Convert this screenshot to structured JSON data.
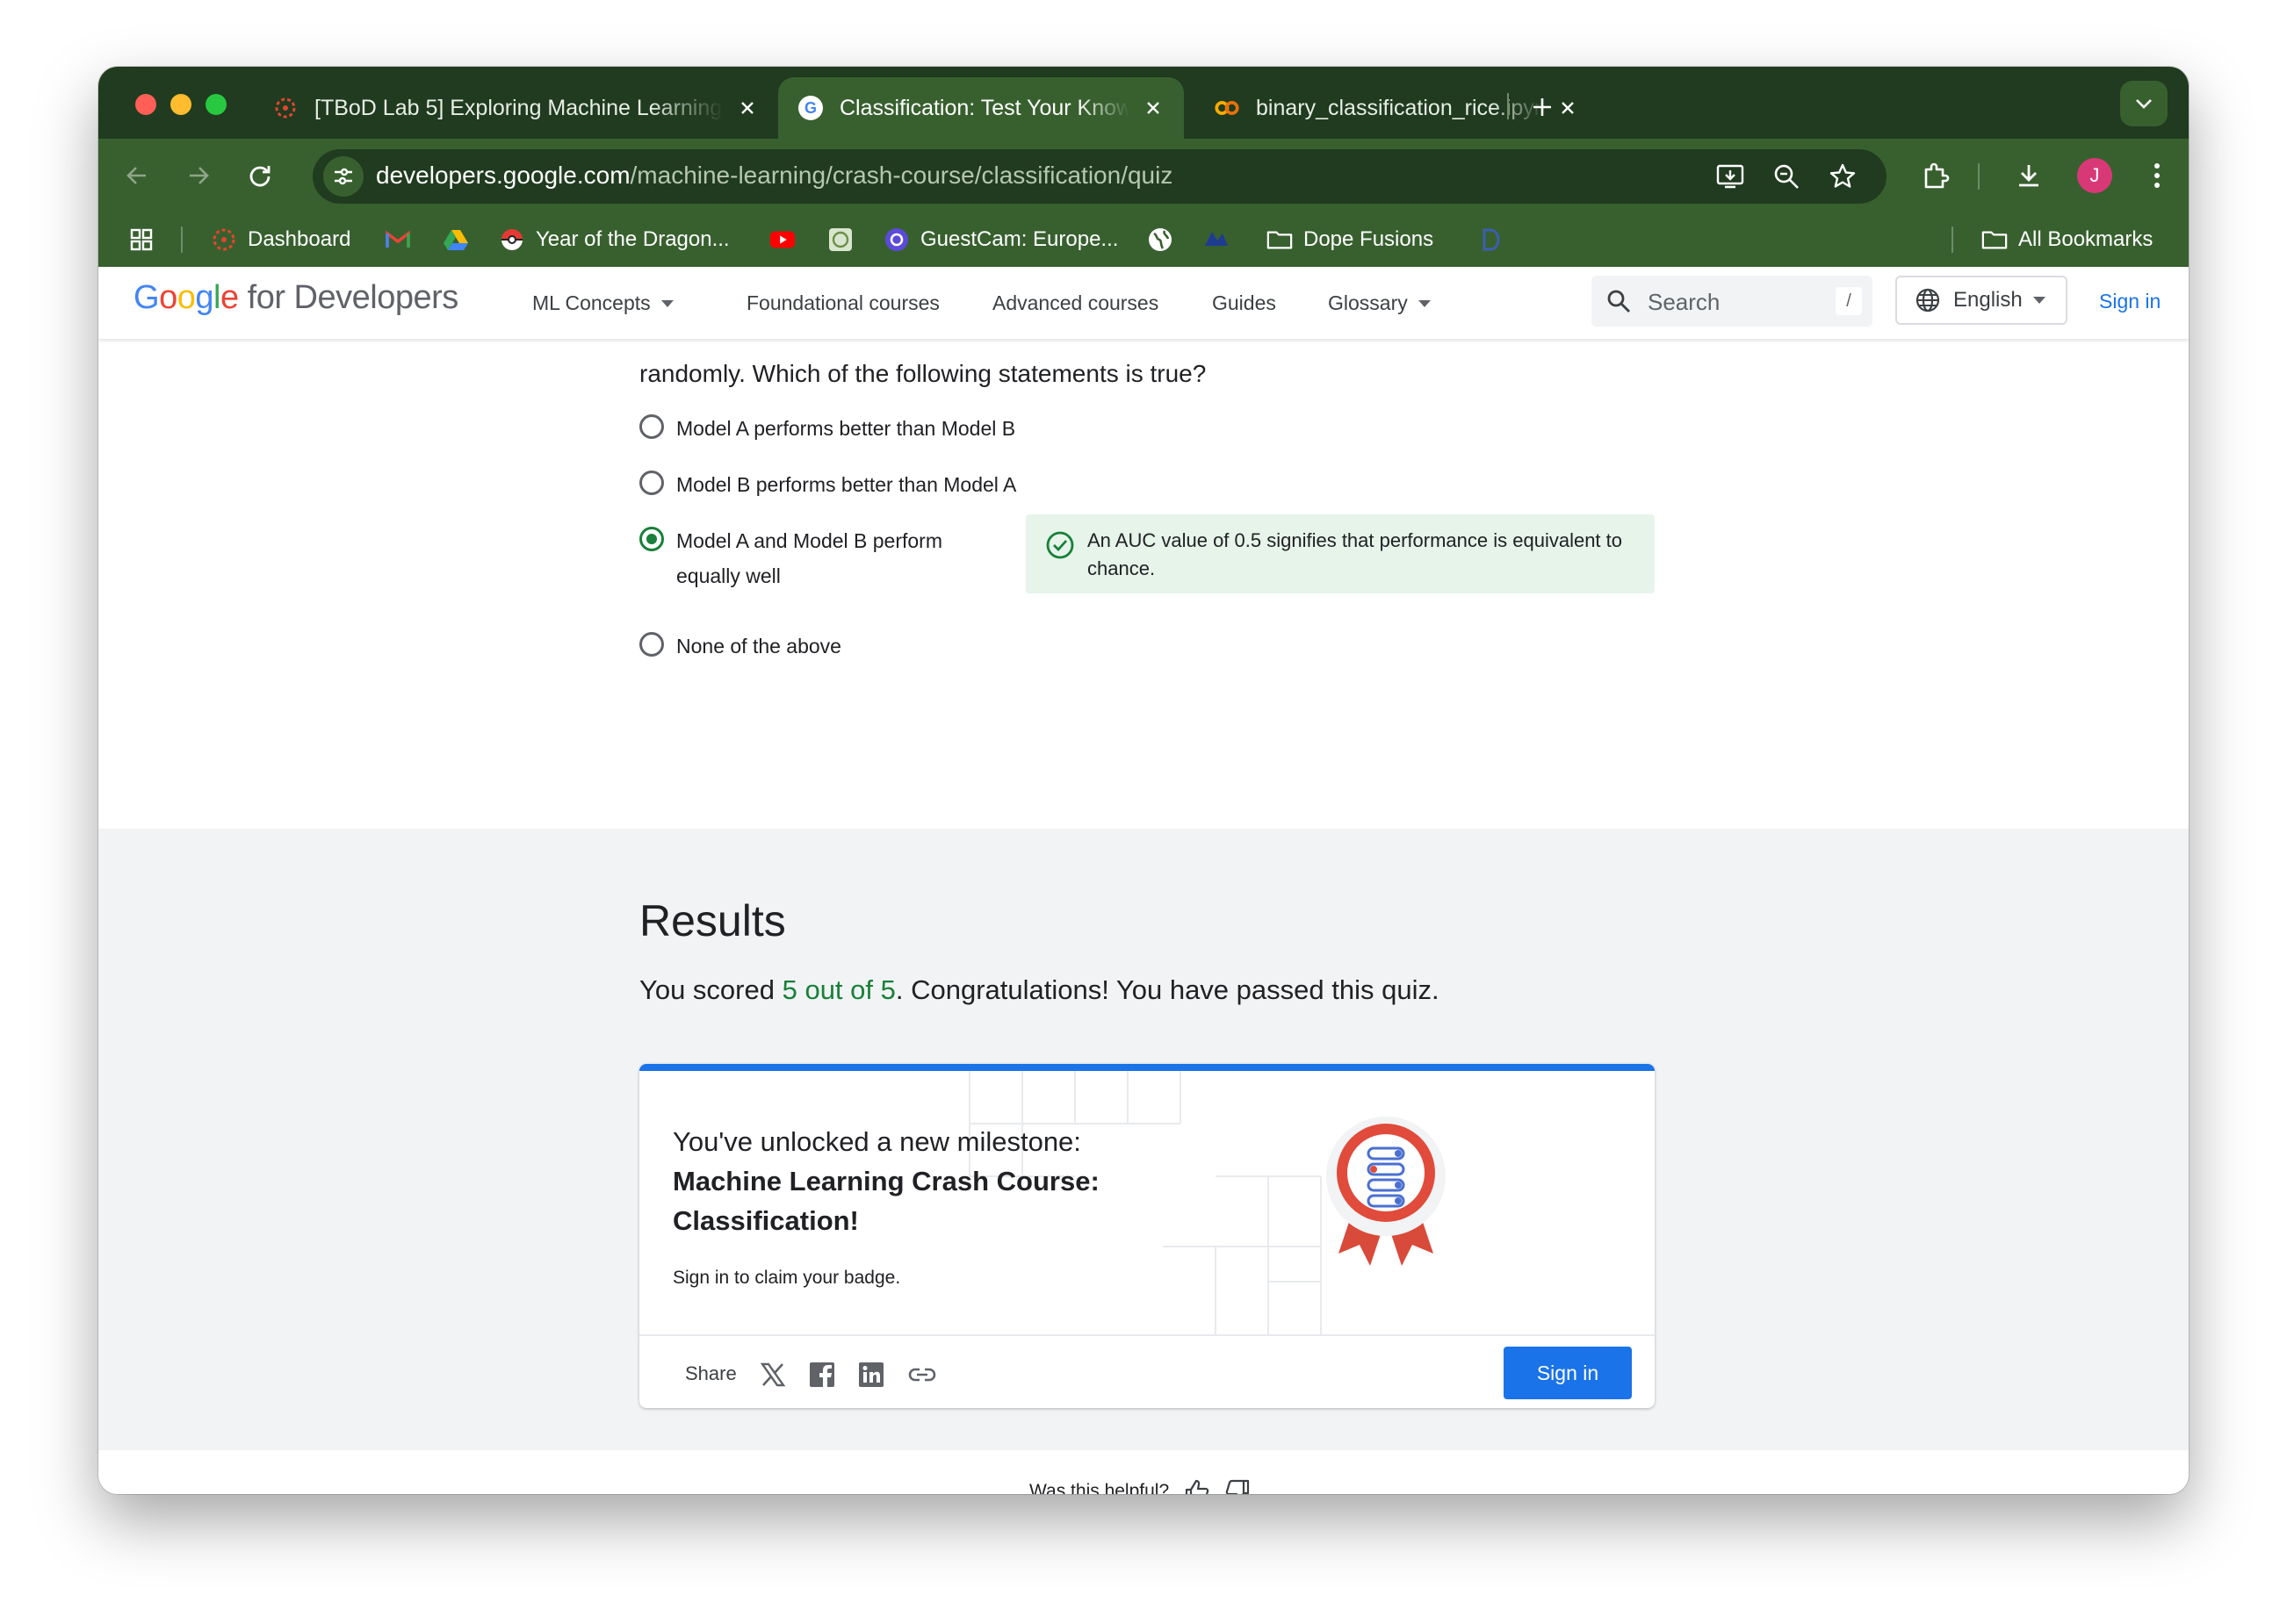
{
  "browser": {
    "tabs": [
      {
        "title": "[TBoD Lab 5] Exploring Machine Learning",
        "favicon": "canvas-icon",
        "active": false
      },
      {
        "title": "Classification: Test Your Knowledge",
        "favicon": "google-g-icon",
        "active": true
      },
      {
        "title": "binary_classification_rice.ipynb",
        "favicon": "colab-icon",
        "active": false
      }
    ],
    "url_domain": "developers.google.com",
    "url_path": "/machine-learning/crash-course/classification/quiz",
    "avatar_initial": "J",
    "bookmarks": [
      {
        "label": "",
        "icon": "apps-grid-icon"
      },
      {
        "label": "Dashboard",
        "icon": "canvas-icon"
      },
      {
        "label": "",
        "icon": "gmail-icon"
      },
      {
        "label": "",
        "icon": "drive-icon"
      },
      {
        "label": "Year of the Dragon...",
        "icon": "pokeball-icon"
      },
      {
        "label": "",
        "icon": "youtube-icon"
      },
      {
        "label": "",
        "icon": "site-icon"
      },
      {
        "label": "GuestCam: Europe...",
        "icon": "guestcam-icon"
      },
      {
        "label": "",
        "icon": "globe-icon"
      },
      {
        "label": "",
        "icon": "site-icon"
      },
      {
        "label": "Dope Fusions",
        "icon": "folder-icon"
      },
      {
        "label": "",
        "icon": "site-icon"
      },
      {
        "label": "All Bookmarks",
        "icon": "folder-icon"
      }
    ],
    "colors": {
      "frame": "#203b1f",
      "toolbar": "#38602f"
    }
  },
  "site": {
    "logo": {
      "google": "Google",
      "suffix": "for Developers"
    },
    "nav": [
      "ML Concepts",
      "Foundational courses",
      "Advanced courses",
      "Guides",
      "Glossary"
    ],
    "search_placeholder": "Search",
    "search_shortcut": "/",
    "language": "English",
    "sign_in": "Sign in"
  },
  "quiz": {
    "question_tail": "randomly. Which of the following statements is true?",
    "options": [
      {
        "label": "Model A performs better than Model B",
        "selected": false
      },
      {
        "label": "Model B performs better than Model A",
        "selected": false
      },
      {
        "label_line1": "Model A and Model B perform",
        "label_line2": "equally well",
        "selected": true
      },
      {
        "label": "None of the above",
        "selected": false
      }
    ],
    "feedback": "An AUC value of 0.5 signifies that performance is equivalent to chance."
  },
  "results": {
    "title": "Results",
    "score_prefix": "You scored ",
    "score_value": "5 out of 5",
    "score_suffix": ". Congratulations! You have passed this quiz.",
    "milestone_intro": "You've unlocked a new milestone:",
    "milestone_line1": "Machine Learning Crash Course:",
    "milestone_line2": "Classification!",
    "claim_text": "Sign in to claim your badge.",
    "share_label": "Share",
    "share_icons": [
      "x-icon",
      "facebook-icon",
      "linkedin-icon",
      "link-icon"
    ],
    "sign_in_button": "Sign in",
    "accent": "#188038",
    "button_color": "#1a73e8"
  },
  "feedback_prompt": {
    "label": "Was this helpful?"
  }
}
